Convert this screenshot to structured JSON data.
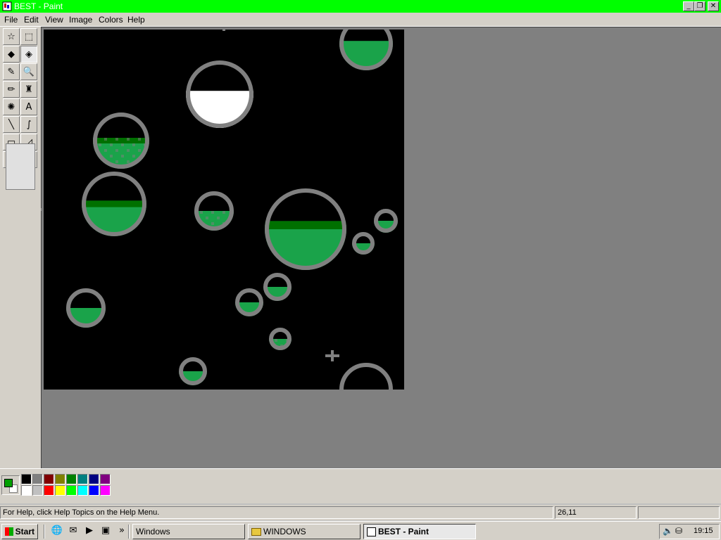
{
  "window": {
    "title": "BEST - Paint",
    "minimize_label": "_",
    "maximize_label": "❐",
    "close_label": "✕"
  },
  "menu": [
    "File",
    "Edit",
    "View",
    "Image",
    "Colors",
    "Help"
  ],
  "tools": [
    {
      "name": "free-form-select",
      "icon": "☆"
    },
    {
      "name": "select",
      "icon": "⬚"
    },
    {
      "name": "eraser",
      "icon": "◆"
    },
    {
      "name": "fill",
      "icon": "◈"
    },
    {
      "name": "pick-color",
      "icon": "✎"
    },
    {
      "name": "magnifier",
      "icon": "🔍"
    },
    {
      "name": "pencil",
      "icon": "✏"
    },
    {
      "name": "brush",
      "icon": "♜"
    },
    {
      "name": "airbrush",
      "icon": "✺"
    },
    {
      "name": "text",
      "icon": "A"
    },
    {
      "name": "line",
      "icon": "╲"
    },
    {
      "name": "curve",
      "icon": "∫"
    },
    {
      "name": "rectangle",
      "icon": "▭"
    },
    {
      "name": "polygon",
      "icon": "◿"
    },
    {
      "name": "ellipse",
      "icon": "⬭"
    },
    {
      "name": "rounded-rectangle",
      "icon": "▢"
    }
  ],
  "active_tool": "fill",
  "colors": {
    "titlebar": "#00ff00",
    "foreground": "#00a000",
    "background": "#ffffff",
    "bubble_rim": "#808080",
    "bubble_green": "#1aa34a",
    "bubble_dark_green": "#007000"
  },
  "palette": [
    "#000000",
    "#808080",
    "#800000",
    "#808000",
    "#008000",
    "#008080",
    "#000080",
    "#800080",
    "#ffffff",
    "#c0c0c0",
    "#ff0000",
    "#ffff00",
    "#00ff00",
    "#00ffff",
    "#0000ff",
    "#ff00ff"
  ],
  "status": {
    "help": "For Help, click Help Topics on the Help Menu.",
    "coords": "26,11",
    "size": ""
  },
  "taskbar": {
    "start_label": "Start",
    "quick_launch": [
      "ie-icon",
      "outlook-icon",
      "media-icon",
      "desktop-icon"
    ],
    "more_label": "»",
    "buttons": [
      {
        "label": "Windows",
        "pressed": false
      },
      {
        "label": "WINDOWS",
        "pressed": false
      },
      {
        "label": "BEST - Paint",
        "pressed": true
      }
    ],
    "clock": "19:15"
  }
}
